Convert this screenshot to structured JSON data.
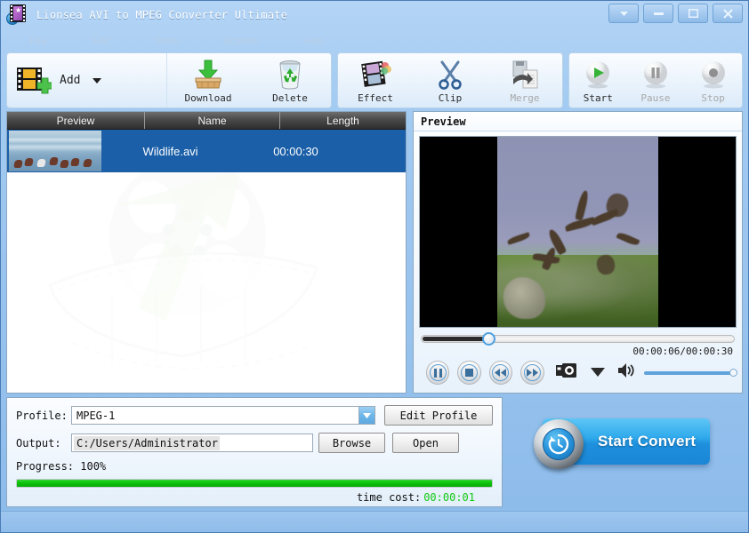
{
  "window": {
    "title": "Lionsea AVI to MPEG Converter Ultimate",
    "app_icon": "filmstrip-icon",
    "buttons": [
      {
        "name": "dropdown",
        "glyph": "▼"
      },
      {
        "name": "minimize",
        "glyph": "–"
      },
      {
        "name": "maximize",
        "glyph": "❐"
      },
      {
        "name": "close",
        "glyph": "✕"
      }
    ]
  },
  "menubar": {
    "items": [
      {
        "label": "File"
      },
      {
        "label": "Edit"
      },
      {
        "label": "Tools"
      },
      {
        "label": "Actions"
      },
      {
        "label": "Help"
      }
    ]
  },
  "toolbar": {
    "add_label": "Add",
    "add_icon": "add-media-icon",
    "add_caret": "▼",
    "items": [
      {
        "label": "Download",
        "icon": "download-box-icon",
        "enabled": true
      },
      {
        "label": "Delete",
        "icon": "recycle-bin-icon",
        "enabled": true
      },
      {
        "label": "Effect",
        "icon": "effect-filmstrip-icon",
        "enabled": true
      },
      {
        "label": "Clip",
        "icon": "scissors-icon",
        "enabled": true
      },
      {
        "label": "Merge",
        "icon": "merge-document-icon",
        "enabled": false
      },
      {
        "label": "Start",
        "icon": "play-circle-icon",
        "enabled": true
      },
      {
        "label": "Pause",
        "icon": "pause-circle-icon",
        "enabled": false
      },
      {
        "label": "Stop",
        "icon": "stop-circle-icon",
        "enabled": false
      }
    ]
  },
  "filelist": {
    "columns": [
      "Preview",
      "Name",
      "Length"
    ],
    "rows": [
      {
        "name": "Wildlife.avi",
        "length": "00:00:30",
        "selected": true
      }
    ],
    "watermark": "film-reel-watermark"
  },
  "preview": {
    "title": "Preview",
    "time_display": "00:00:06/00:00:30",
    "current_time": "00:00:06",
    "total_time": "00:00:30",
    "seek_percent": 20,
    "volume_percent": 100,
    "controls": [
      {
        "name": "pause-button",
        "icon": "pause-icon"
      },
      {
        "name": "stop-button",
        "icon": "stop-icon"
      },
      {
        "name": "rewind-button",
        "icon": "rewind-icon"
      },
      {
        "name": "forward-button",
        "icon": "fast-forward-icon"
      },
      {
        "name": "snapshot-button",
        "icon": "camera-icon"
      },
      {
        "name": "snapshot-menu-button",
        "icon": "chevron-down-icon"
      },
      {
        "name": "volume-button",
        "icon": "speaker-icon"
      }
    ]
  },
  "settings": {
    "profile_label": "Profile:",
    "profile_value": "MPEG-1",
    "edit_profile_label": "Edit Profile",
    "output_label": "Output:",
    "output_value": "C:/Users/Administrator",
    "browse_label": "Browse",
    "open_label": "Open",
    "progress_label": "Progress: 100%",
    "progress_percent": 100,
    "timecost_label": "time cost:",
    "timecost_value": "00:00:01"
  },
  "convert": {
    "label": "Start Convert",
    "icon": "clock-convert-icon"
  },
  "colors": {
    "title_bar": "#9cc6f0",
    "accent_blue": "#1e90dd",
    "selection_blue": "#1a5fa8",
    "progress_green": "#0bc40b",
    "timecost_green": "#12c912",
    "list_header_dark": "#4a4a4a"
  }
}
